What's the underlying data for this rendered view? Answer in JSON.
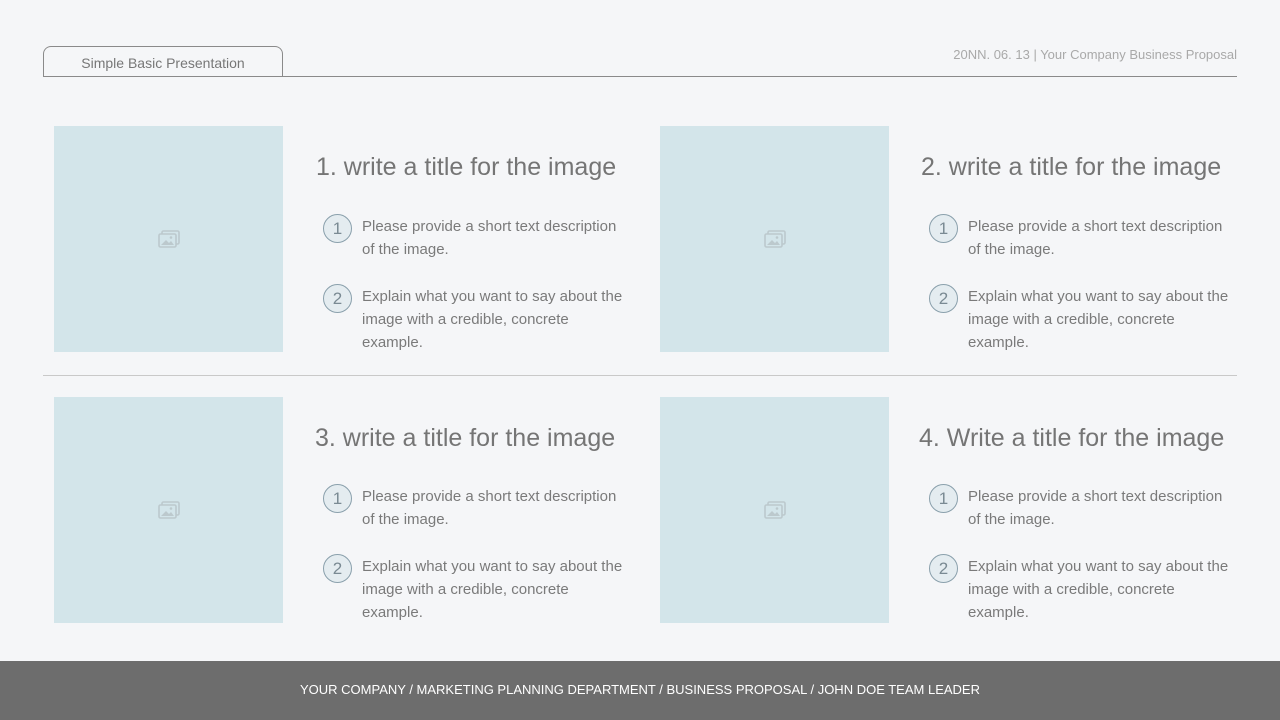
{
  "header": {
    "tab_label": "Simple Basic Presentation",
    "right_text": "20NN. 06. 13 | Your Company Business Proposal"
  },
  "cards": [
    {
      "title": "1. write a title for the image",
      "bullets": [
        {
          "num": "1",
          "text": "Please provide a short text description of the image."
        },
        {
          "num": "2",
          "text": "Explain what you want to say about the image with a credible, concrete example."
        }
      ]
    },
    {
      "title": "2. write a title for the image",
      "bullets": [
        {
          "num": "1",
          "text": "Please provide a short text description of the image."
        },
        {
          "num": "2",
          "text": "Explain what you want to say about the image with a credible, concrete example."
        }
      ]
    },
    {
      "title": "3. write a title for the image",
      "bullets": [
        {
          "num": "1",
          "text": "Please provide a short text description of the image."
        },
        {
          "num": "2",
          "text": "Explain what you want to say about the image with a credible, concrete example."
        }
      ]
    },
    {
      "title": "4. Write a title for the image",
      "bullets": [
        {
          "num": "1",
          "text": "Please provide a short text description of the image."
        },
        {
          "num": "2",
          "text": "Explain what you want to say about the image with a credible, concrete example."
        }
      ]
    }
  ],
  "footer": {
    "text": "YOUR COMPANY / MARKETING PLANNING DEPARTMENT / BUSINESS PROPOSAL / JOHN DOE TEAM LEADER"
  },
  "icons": {
    "image_placeholder": "image-icon"
  },
  "colors": {
    "placeholder_bg": "#d3e5ea",
    "footer_bg": "#6d6d6d",
    "background": "#f5f6f8"
  }
}
